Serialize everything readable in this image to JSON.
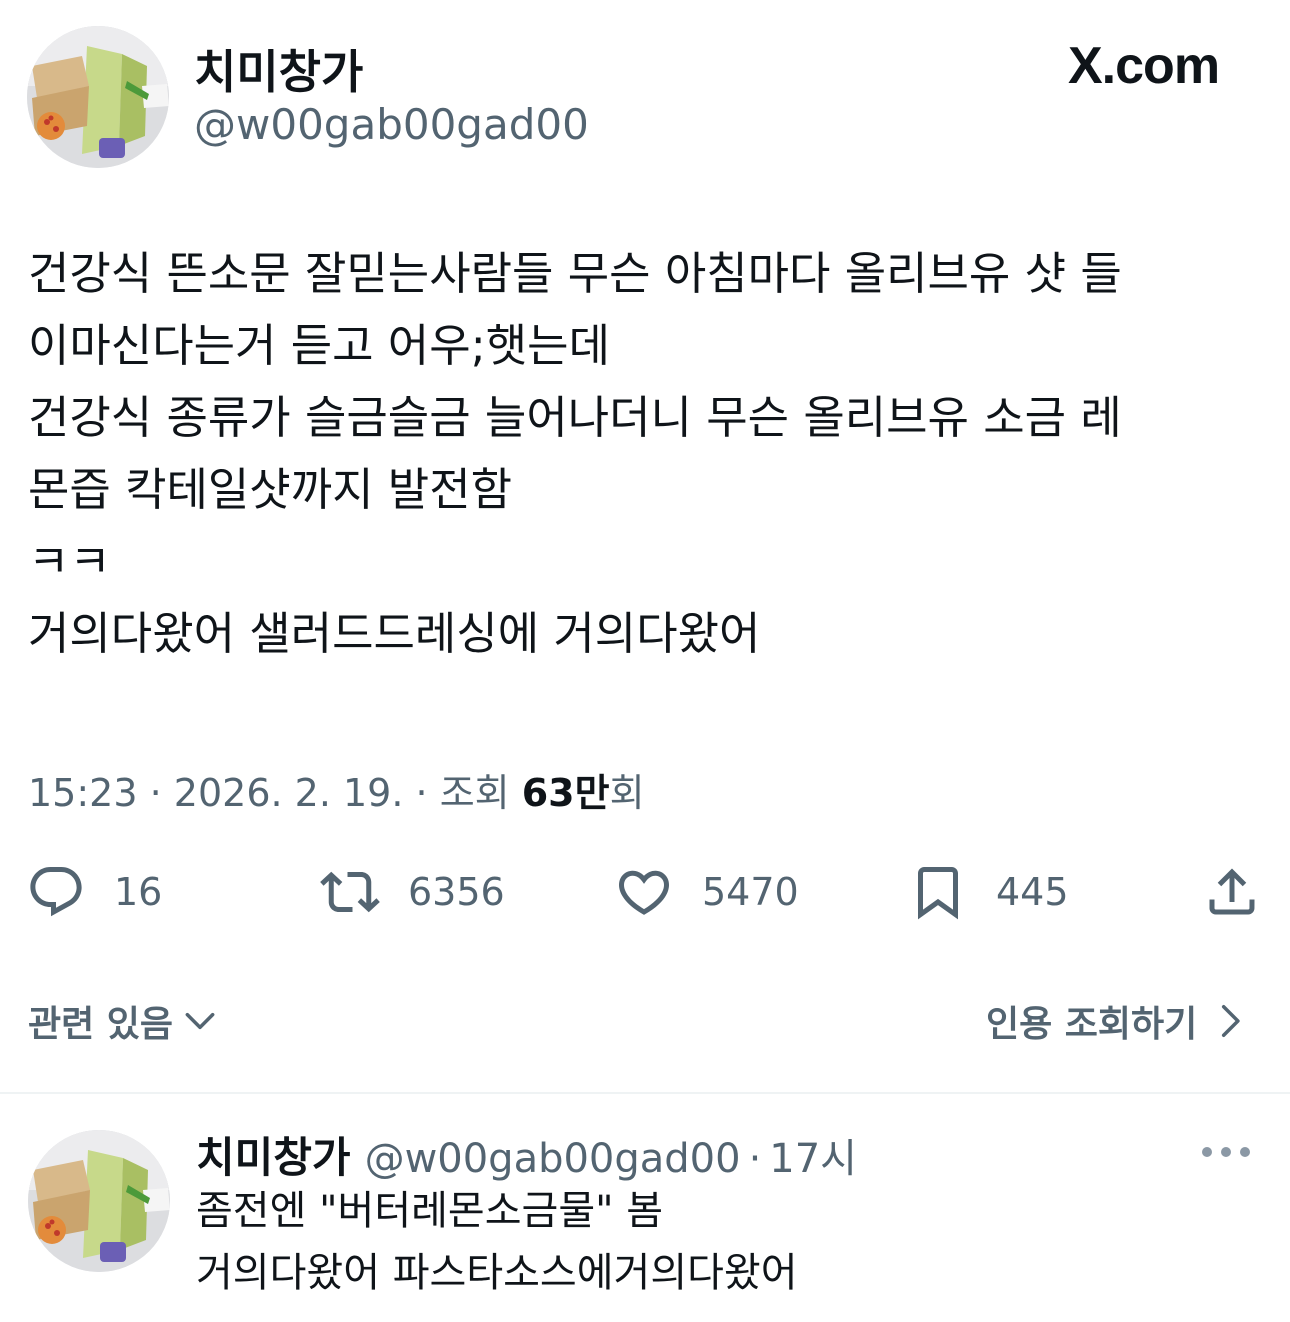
{
  "brand": {
    "label": "X.com"
  },
  "author": {
    "display_name": "치미창가",
    "handle": "@w00gab00gad00"
  },
  "tweet": {
    "lines": [
      "건강식 뜬소문 잘믿는사람들 무슨 아침마다 올리브유 샷 들",
      "이마신다는거 듣고 어우;햇는데",
      "건강식 종류가 슬금슬금 늘어나더니 무슨 올리브유 소금 레",
      "몬즙 칵테일샷까지 발전함",
      "ㅋㅋ",
      "거의다왔어 샐러드드레싱에 거의다왔어"
    ]
  },
  "meta": {
    "time": "15:23",
    "separator": "·",
    "date": "2026. 2. 19.",
    "views_prefix": "조회",
    "views_value": "63만",
    "views_suffix": "회"
  },
  "actions": {
    "replies": "16",
    "retweets": "6356",
    "likes": "5470",
    "bookmarks": "445"
  },
  "links": {
    "related": "관련 있음",
    "quotes": "인용 조회하기"
  },
  "reply": {
    "display_name": "치미창가",
    "handle": "@w00gab00gad00",
    "separator": "·",
    "time": "17시",
    "lines": [
      "좀전엔 \"버터레몬소금물\" 봄",
      "거의다왔어 파스타소스에거의다왔어"
    ]
  },
  "icons": {
    "reply": "speech-bubble-icon",
    "retweet": "retweet-icon",
    "like": "heart-icon",
    "bookmark": "bookmark-icon",
    "share": "share-icon",
    "chevron_down": "chevron-down-icon",
    "chevron_right": "chevron-right-icon",
    "more": "more-dots-icon"
  },
  "colors": {
    "text_primary": "#0f1419",
    "text_secondary": "#536471",
    "divider": "#eff3f4"
  }
}
